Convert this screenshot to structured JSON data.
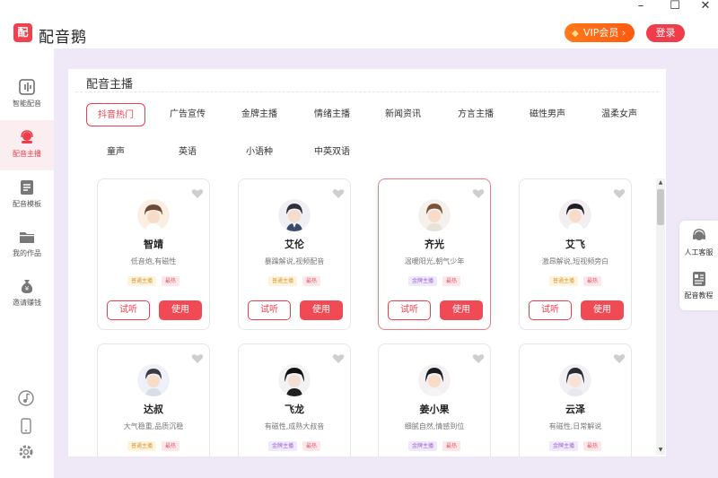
{
  "app": {
    "logo_char": "配",
    "name": "配音鹅",
    "vip_label": "VIP会员 ›",
    "login_label": "登录",
    "window": {
      "min": "–",
      "max": "☐",
      "close": "✕"
    }
  },
  "sidebar": {
    "items": [
      {
        "label": "智能配音",
        "icon": "soundwave-icon"
      },
      {
        "label": "配音主播",
        "icon": "headset-icon",
        "active": true
      },
      {
        "label": "配音模板",
        "icon": "template-icon"
      },
      {
        "label": "我的作品",
        "icon": "folder-icon"
      },
      {
        "label": "邀请赚钱",
        "icon": "money-bag-icon"
      }
    ],
    "bottom_icons": [
      "music-note-icon",
      "phone-icon",
      "settings-gear-icon"
    ]
  },
  "panel": {
    "title": "配音主播",
    "tabs_row1": [
      "抖音热门",
      "广告宣传",
      "金牌主播",
      "情绪主播",
      "新闻资讯",
      "方言主播",
      "磁性男声",
      "温柔女声"
    ],
    "tabs_row2": [
      "童声",
      "英语",
      "小语种",
      "中英双语"
    ],
    "active_tab": "抖音热门"
  },
  "cards": [
    {
      "name": "智靖",
      "desc": "低音炮,有磁性",
      "tags": [
        {
          "text": "普通主播",
          "type": "yellow"
        },
        {
          "text": "最热",
          "type": "pink"
        }
      ],
      "try": "试听",
      "use": "使用",
      "selected": false
    },
    {
      "name": "艾伦",
      "desc": "暴躁解说,视频配音",
      "tags": [
        {
          "text": "普通主播",
          "type": "yellow"
        },
        {
          "text": "最热",
          "type": "pink"
        }
      ],
      "try": "试听",
      "use": "使用",
      "selected": false
    },
    {
      "name": "齐光",
      "desc": "温暖阳光,朝气少年",
      "tags": [
        {
          "text": "金牌主播",
          "type": "purple"
        },
        {
          "text": "最热",
          "type": "pink"
        }
      ],
      "try": "试听",
      "use": "使用",
      "selected": true
    },
    {
      "name": "艾飞",
      "desc": "激昂解说,短视频旁白",
      "tags": [
        {
          "text": "普通主播",
          "type": "yellow"
        },
        {
          "text": "最热",
          "type": "pink"
        }
      ],
      "try": "试听",
      "use": "使用",
      "selected": false
    },
    {
      "name": "达叔",
      "desc": "大气稳重,品质沉稳",
      "tags": [
        {
          "text": "普通主播",
          "type": "yellow"
        },
        {
          "text": "最热",
          "type": "pink"
        }
      ],
      "selected": false
    },
    {
      "name": "飞龙",
      "desc": "有磁性,成熟大叔音",
      "tags": [
        {
          "text": "金牌主播",
          "type": "purple"
        },
        {
          "text": "最热",
          "type": "pink"
        }
      ],
      "selected": false
    },
    {
      "name": "姜小果",
      "desc": "细腻自然,情感到位",
      "tags": [
        {
          "text": "金牌主播",
          "type": "purple"
        },
        {
          "text": "最热",
          "type": "pink"
        }
      ],
      "selected": false
    },
    {
      "name": "云泽",
      "desc": "有磁性,日常解说",
      "tags": [
        {
          "text": "金牌主播",
          "type": "purple"
        },
        {
          "text": "最热",
          "type": "pink"
        }
      ],
      "selected": false
    }
  ],
  "float": {
    "items": [
      {
        "label": "人工客服",
        "icon": "customer-service-icon"
      },
      {
        "label": "配音教程",
        "icon": "tutorial-book-icon"
      }
    ]
  },
  "colors": {
    "accent": "#f03c4b",
    "vip": "#ff6a14",
    "main_bg": "#efe8f6"
  }
}
